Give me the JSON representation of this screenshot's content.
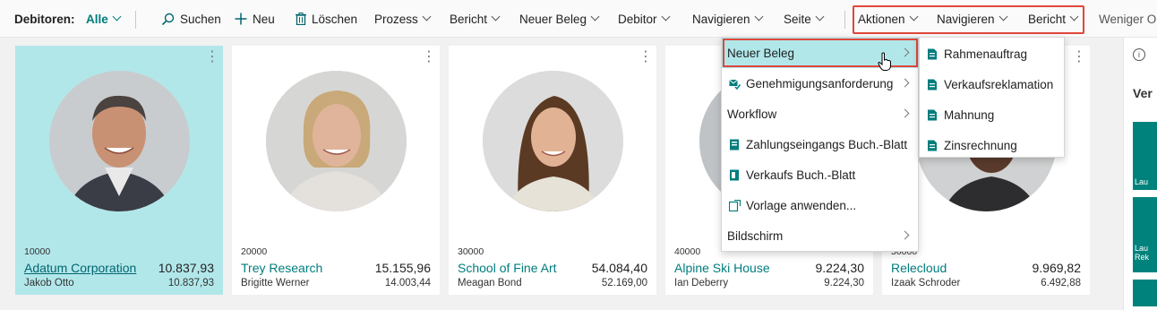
{
  "actionbar": {
    "title": "Debitoren:",
    "filter": "Alle",
    "search": "Suchen",
    "new": "Neu",
    "delete": "Löschen",
    "process": "Prozess",
    "report": "Bericht",
    "new_document": "Neuer Beleg",
    "customer": "Debitor",
    "navigate": "Navigieren",
    "page": "Seite",
    "actions": "Aktionen",
    "navigate2": "Navigieren",
    "report2": "Bericht",
    "less": "Weniger O"
  },
  "cards": [
    {
      "number": "10000",
      "name": "Adatum Corporation",
      "balance": "10.837,93",
      "contact": "Jakob Otto",
      "balance_due": "10.837,93"
    },
    {
      "number": "20000",
      "name": "Trey Research",
      "balance": "15.155,96",
      "contact": "Brigitte Werner",
      "balance_due": "14.003,44"
    },
    {
      "number": "30000",
      "name": "School of Fine Art",
      "balance": "54.084,40",
      "contact": "Meagan Bond",
      "balance_due": "52.169,00"
    },
    {
      "number": "40000",
      "name": "Alpine Ski House",
      "balance": "9.224,30",
      "contact": "Ian Deberry",
      "balance_due": "9.224,30"
    },
    {
      "number": "50000",
      "name": "Relecloud",
      "balance": "9.969,82",
      "contact": "Izaak Schroder",
      "balance_due": "6.492,88"
    }
  ],
  "actions_menu": {
    "items": [
      {
        "label": "Neuer Beleg",
        "icon": "none",
        "submenu": true
      },
      {
        "label": "Genehmigungsanforderung",
        "icon": "approval-icon",
        "submenu": true
      },
      {
        "label": "Workflow",
        "icon": "none",
        "submenu": true
      },
      {
        "label": "Zahlungseingangs Buch.-Blatt",
        "icon": "journal-icon",
        "submenu": false
      },
      {
        "label": "Verkaufs Buch.-Blatt",
        "icon": "journal-icon",
        "submenu": false
      },
      {
        "label": "Vorlage anwenden...",
        "icon": "template-icon",
        "submenu": false
      },
      {
        "label": "Bildschirm",
        "icon": "none",
        "submenu": true
      }
    ]
  },
  "new_document_submenu": {
    "items": [
      {
        "label": "Rahmenauftrag",
        "icon": "document-icon"
      },
      {
        "label": "Verkaufsreklamation",
        "icon": "document-icon"
      },
      {
        "label": "Mahnung",
        "icon": "document-icon"
      },
      {
        "label": "Zinsrechnung",
        "icon": "document-icon"
      }
    ]
  },
  "sidepanel": {
    "info": "i",
    "heading": "Ver",
    "tile1": "Lau",
    "tile2": "Lau Rek"
  },
  "colors": {
    "accent": "#007d7d",
    "selected_card": "#b2e7ea",
    "highlight_border": "#e0473b"
  }
}
